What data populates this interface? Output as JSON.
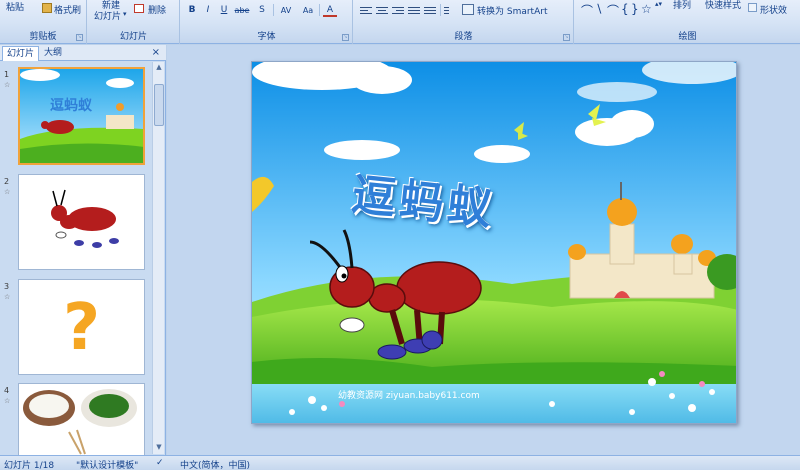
{
  "ribbon": {
    "clipboard": {
      "paste": "粘贴",
      "format_painter": "格式刷",
      "label": "剪贴板"
    },
    "slides": {
      "new_slide_line1": "新建",
      "new_slide_line2": "幻灯片",
      "delete": "删除",
      "label": "幻灯片"
    },
    "font": {
      "bold": "B",
      "italic": "I",
      "underline": "U",
      "strike": "abe",
      "shadow": "S",
      "spacing": "AV",
      "case": "Aa",
      "color": "A",
      "label": "字体"
    },
    "paragraph": {
      "smartart": "转换为 SmartArt",
      "label": "段落"
    },
    "drawing": {
      "arrange": "排列",
      "quick_styles": "快速样式",
      "shape_fill": "形状效",
      "label": "绘图"
    }
  },
  "sidebar": {
    "tabs": [
      {
        "label": "幻灯片"
      },
      {
        "label": "大纲"
      }
    ],
    "close": "×",
    "slides": [
      {
        "number": "1",
        "anim": "☆"
      },
      {
        "number": "2",
        "anim": "☆"
      },
      {
        "number": "3",
        "anim": "☆"
      },
      {
        "number": "4",
        "anim": "☆"
      }
    ],
    "thumb1_title": "逗蚂蚁",
    "thumb3_mark": "?"
  },
  "slide": {
    "title": "逗蚂蚁",
    "watermark": "幼教资源网 ziyuan.baby611.com"
  },
  "status": {
    "slide_index": "幻灯片 1/18",
    "template": "\"默认设计模板\"",
    "language": "中文(简体，中国)"
  },
  "colors": {
    "ribbon_bg": "#d5e3f5",
    "title_blue": "#2f7fd8",
    "ant_red": "#b41d1d",
    "selected_border": "#f0a23b"
  }
}
